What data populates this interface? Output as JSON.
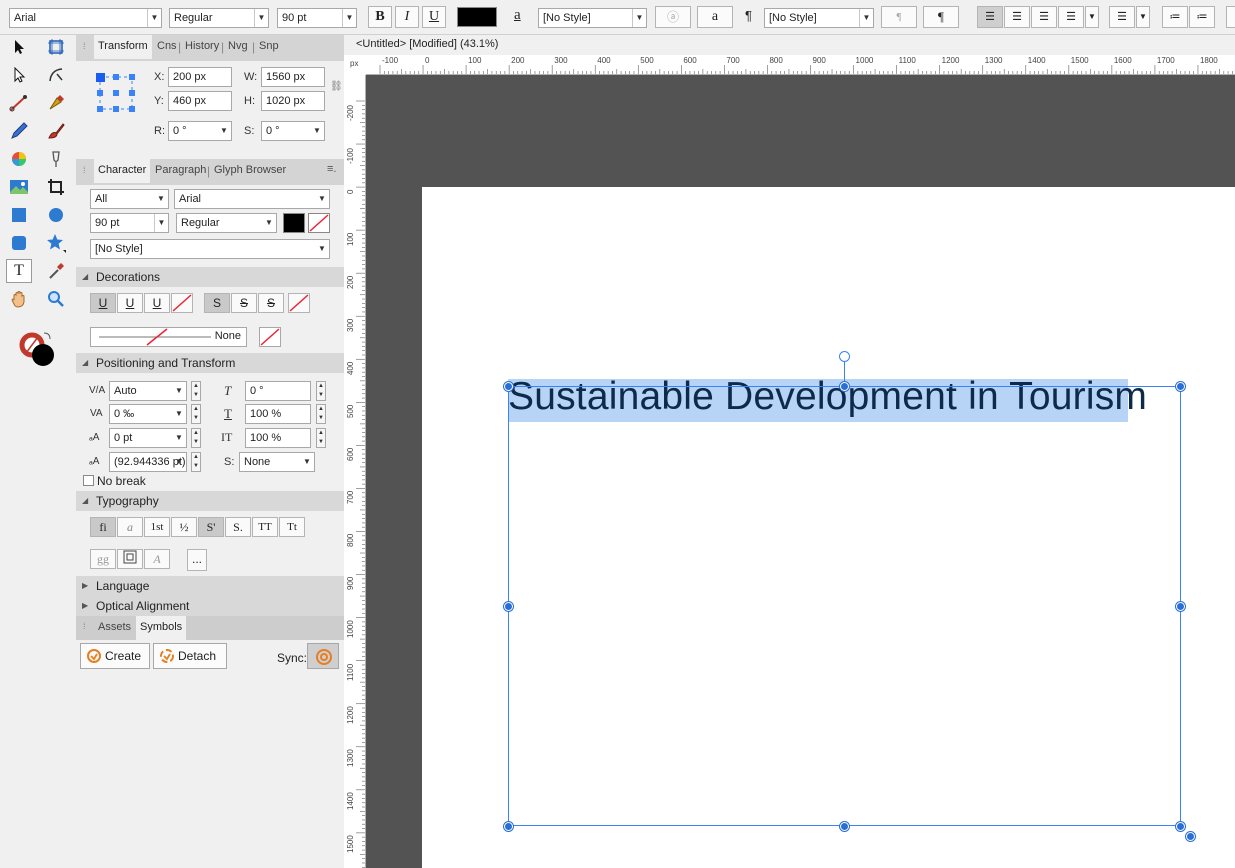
{
  "context_toolbar": {
    "font": "Arial",
    "weight": "Regular",
    "size": "90 pt",
    "bold": "B",
    "italic": "I",
    "underline": "U",
    "char_style": "[No Style]",
    "para_style": "[No Style]",
    "colors": {
      "fill": "#000000"
    }
  },
  "document": {
    "tab_title": "<Untitled> [Modified] (43.1%)"
  },
  "ruler": {
    "unit": "px",
    "h_ticks": [
      "-100",
      "0",
      "100",
      "200",
      "300",
      "400",
      "500",
      "600",
      "700",
      "800",
      "900",
      "1000",
      "1100",
      "1200",
      "1300",
      "1400",
      "1500",
      "1600",
      "1700",
      "1800"
    ],
    "v_ticks": [
      "-200",
      "-100",
      "0",
      "100",
      "200",
      "300",
      "400",
      "500",
      "600",
      "700",
      "800",
      "900",
      "1000",
      "1100",
      "1200",
      "1300",
      "1400",
      "1500"
    ]
  },
  "transform_panel": {
    "tabs": [
      "Transform",
      "Cns",
      "History",
      "Nvg",
      "Snp"
    ],
    "x_label": "X:",
    "x": "200 px",
    "y_label": "Y:",
    "y": "460 px",
    "w_label": "W:",
    "w": "1560 px",
    "h_label": "H:",
    "h": "1020 px",
    "r_label": "R:",
    "r": "0 °",
    "s_label": "S:",
    "s": "0 °"
  },
  "character_panel": {
    "tabs": [
      "Character",
      "Paragraph",
      "Glyph Browser"
    ],
    "scope": "All",
    "font": "Arial",
    "size": "90 pt",
    "weight": "Regular",
    "style": "[No Style]",
    "decorations": {
      "title": "Decorations",
      "line_label": "None"
    },
    "positioning": {
      "title": "Positioning and Transform",
      "kerning": "Auto",
      "tracking": "0 ‰",
      "baseline": "0 pt",
      "leading": "(92.944336 pt)",
      "shear": "0 °",
      "h_scale": "100 %",
      "v_scale": "100 %",
      "s_label": "S:",
      "shadow": "None",
      "no_break": "No break"
    },
    "typography": {
      "title": "Typography",
      "items": [
        "fi",
        "a",
        "1st",
        "½",
        "S'",
        "S.",
        "TT",
        "Tt"
      ],
      "more": "..."
    },
    "language": "Language",
    "optical_alignment": "Optical Alignment"
  },
  "symbols_panel": {
    "tabs": [
      "Assets",
      "Symbols"
    ],
    "create": "Create",
    "detach": "Detach",
    "sync": "Sync:"
  },
  "canvas": {
    "text": "Sustainable Development in Tourism",
    "selection_color": "#b7d3f5",
    "handle_color": "#2a6fd6"
  }
}
